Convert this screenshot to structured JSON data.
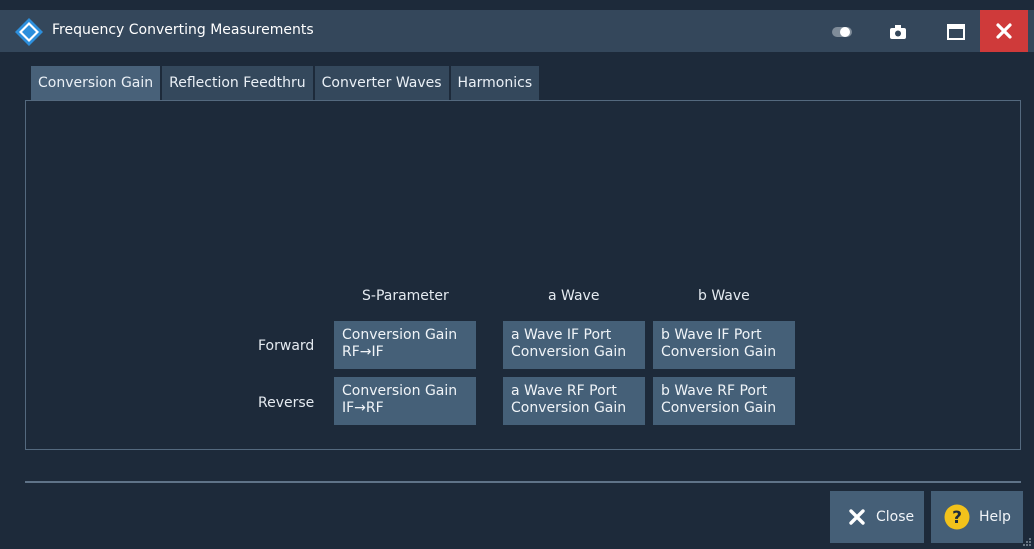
{
  "window": {
    "title": "Frequency Converting Measurements"
  },
  "tabs": [
    {
      "label": "Conversion Gain",
      "active": true
    },
    {
      "label": "Reflection Feedthru",
      "active": false
    },
    {
      "label": "Converter Waves",
      "active": false
    },
    {
      "label": "Harmonics",
      "active": false
    }
  ],
  "grid": {
    "columns": [
      "S-Parameter",
      "a Wave",
      "b Wave"
    ],
    "rows": [
      "Forward",
      "Reverse"
    ],
    "cells": {
      "forward": {
        "s_param": [
          "Conversion Gain",
          "RF→IF"
        ],
        "a_wave": [
          "a Wave IF Port",
          "Conversion Gain"
        ],
        "b_wave": [
          "b Wave IF Port",
          "Conversion Gain"
        ]
      },
      "reverse": {
        "s_param": [
          "Conversion Gain",
          "IF→RF"
        ],
        "a_wave": [
          "a Wave RF Port",
          "Conversion Gain"
        ],
        "b_wave": [
          "b Wave RF Port",
          "Conversion Gain"
        ]
      }
    }
  },
  "footer": {
    "close_label": "Close",
    "help_label": "Help"
  },
  "icons": {
    "logo": "rohde-schwarz-logo",
    "toggle": "toggle-icon",
    "camera": "camera-icon",
    "maximize": "maximize-icon",
    "close": "close-icon",
    "help": "help-icon"
  },
  "colors": {
    "close_red": "#cf3a3a",
    "help_yellow": "#f2c21b",
    "accent_button": "#456078"
  }
}
